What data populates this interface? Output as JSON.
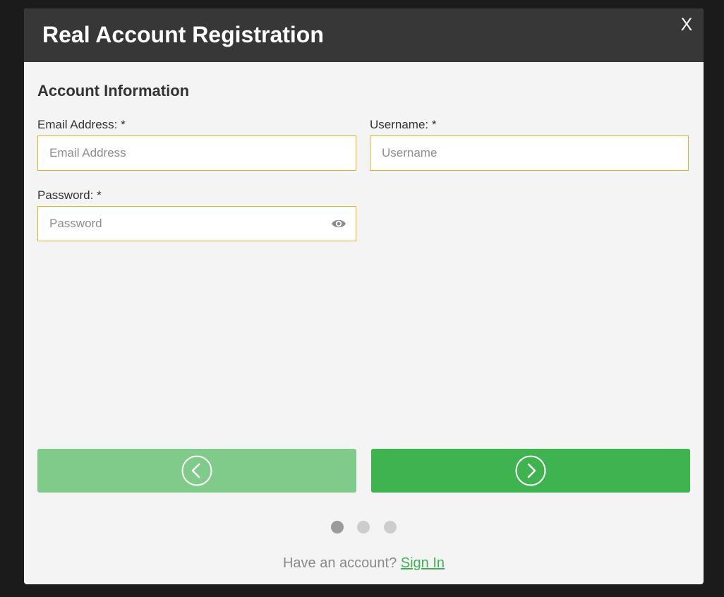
{
  "modal": {
    "title": "Real Account Registration",
    "close_label": "X"
  },
  "section": {
    "title": "Account Information"
  },
  "fields": {
    "email": {
      "label": "Email Address: *",
      "placeholder": "Email Address",
      "value": ""
    },
    "username": {
      "label": "Username: *",
      "placeholder": "Username",
      "value": ""
    },
    "password": {
      "label": "Password: *",
      "placeholder": "Password",
      "value": ""
    }
  },
  "navigation": {
    "prev_icon": "chevron-left-circle-icon",
    "next_icon": "chevron-right-circle-icon",
    "prev_color": "#80cb8a",
    "next_color": "#40b351"
  },
  "steps": {
    "total": 3,
    "current": 1,
    "active_color": "#9b9b9b",
    "inactive_color": "#cdcdcd"
  },
  "footer": {
    "prompt": "Have an account?",
    "link": "Sign In"
  },
  "colors": {
    "accent_border": "#e6b12a",
    "header_bg": "#373737",
    "link": "#40b351"
  }
}
